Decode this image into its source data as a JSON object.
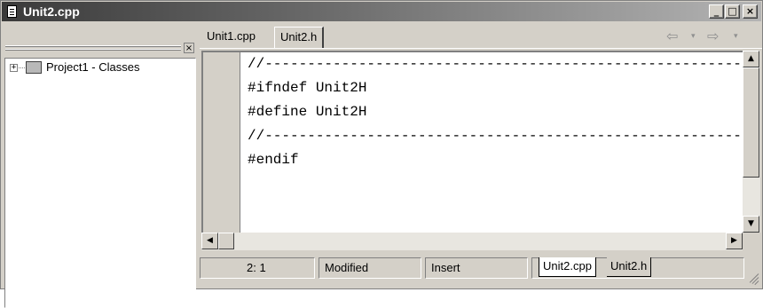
{
  "window": {
    "title": "Unit2.cpp",
    "controls": {
      "minimize": "_",
      "maximize": "□",
      "close": "×"
    }
  },
  "class_explorer": {
    "close_glyph": "×",
    "tree": [
      {
        "expander": "+",
        "icon": "classes-folder-icon",
        "label": "Project1 - Classes"
      }
    ]
  },
  "editor": {
    "tabs": [
      {
        "label": "Unit1.cpp",
        "active": false
      },
      {
        "label": "Unit2.h",
        "active": true
      }
    ],
    "nav": {
      "back": "⇦",
      "forward": "⇨",
      "dropdown": "▾"
    },
    "code_lines": [
      "//---------------------------------------------------------------------------",
      "#ifndef Unit2H",
      "#define Unit2H",
      "//---------------------------------------------------------------------------",
      "#endif"
    ]
  },
  "status_bar": {
    "position": "2:  1",
    "modified": "Modified",
    "mode": "Insert",
    "file_tabs": [
      {
        "label": "Unit2.cpp",
        "active": true
      },
      {
        "label": "Unit2.h",
        "active": false
      }
    ]
  }
}
